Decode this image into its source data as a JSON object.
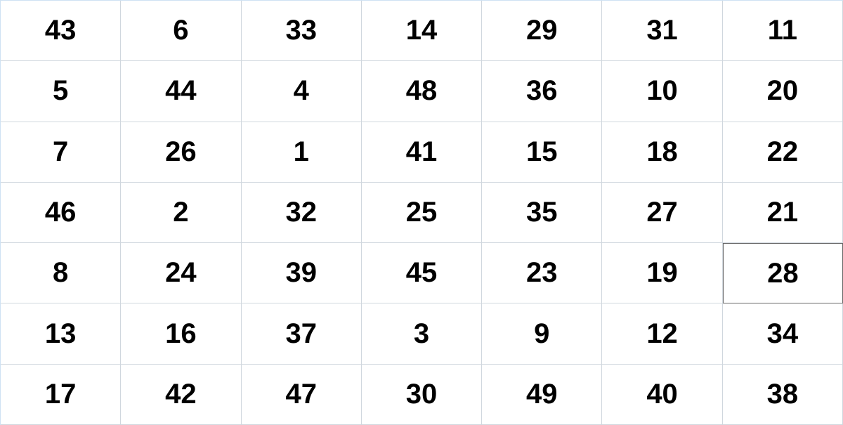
{
  "grid": {
    "rows": [
      [
        "43",
        "6",
        "33",
        "14",
        "29",
        "31",
        "11"
      ],
      [
        "5",
        "44",
        "4",
        "48",
        "36",
        "10",
        "20"
      ],
      [
        "7",
        "26",
        "1",
        "41",
        "15",
        "18",
        "22"
      ],
      [
        "46",
        "2",
        "32",
        "25",
        "35",
        "27",
        "21"
      ],
      [
        "8",
        "24",
        "39",
        "45",
        "23",
        "19",
        "28"
      ],
      [
        "13",
        "16",
        "37",
        "3",
        "9",
        "12",
        "34"
      ],
      [
        "17",
        "42",
        "47",
        "30",
        "49",
        "40",
        "38"
      ]
    ],
    "selected_cell": {
      "row": 4,
      "col": 6
    }
  }
}
